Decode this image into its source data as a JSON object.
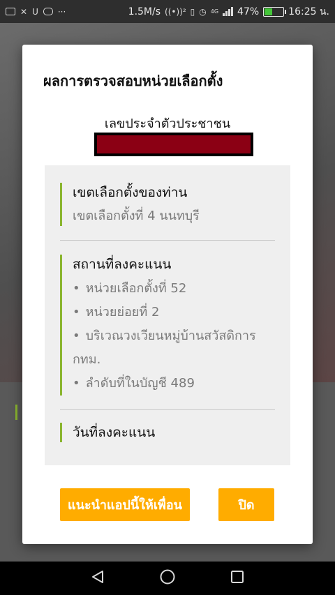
{
  "status_bar": {
    "network_speed": "1.5M/s",
    "battery_percent": "47%",
    "battery_level": 0.47,
    "time": "16:25 น.",
    "left_icons": [
      "mail-icon",
      "missed-call-icon",
      "u-icon",
      "line-icon",
      "more-icon"
    ],
    "right_icons": [
      "hotspot-icon",
      "vibrate-icon",
      "alarm-icon",
      "signal-4g-icon",
      "battery-icon"
    ],
    "u_text": "U",
    "more_text": "···",
    "hotspot_text": "((•))²",
    "vibrate_text": "▯",
    "alarm_text": "◷",
    "net_type_text": "4G"
  },
  "dialog": {
    "title": "ผลการตรวจสอบหน่วยเลือกตั้ง",
    "id_label": "เลขประจำตัวประชาชน",
    "sections": {
      "district": {
        "heading": "เขตเลือกตั้งของท่าน",
        "value": "เขตเลือกตั้งที่ 4 นนทบุรี"
      },
      "place": {
        "heading": "สถานที่ลงคะแนน",
        "items": [
          "หน่วยเลือกตั้งที่ 52",
          "หน่วยย่อยที่ 2",
          "บริเวณวงเวียนหมู่บ้านสวัสดิการ กทม.",
          "ลำดับที่ในบัญชี 489"
        ]
      },
      "date": {
        "heading": "วันที่ลงคะแนน"
      }
    },
    "buttons": {
      "share": "แนะนำแอปนี้ให้เพื่อน",
      "close": "ปิด"
    }
  },
  "nav_bar": {
    "icons": [
      "back-icon",
      "home-icon",
      "recents-icon"
    ]
  },
  "colors": {
    "accent_green": "#8ab52f",
    "button_orange": "#ffac00",
    "redaction": "#8b0014"
  }
}
